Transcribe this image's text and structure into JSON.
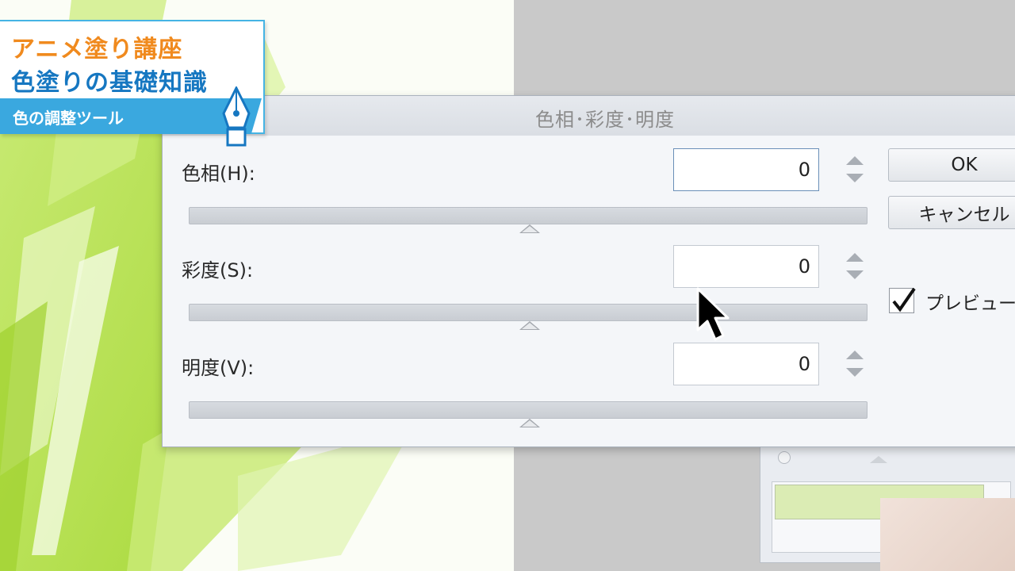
{
  "tutorial": {
    "line1": "アニメ塗り講座",
    "line2": "色塗りの基礎知識",
    "section": "色の調整ツール",
    "accent_orange": "#f08a1e",
    "accent_blue": "#1677c1",
    "ribbon_color": "#3aa8df",
    "icon": "pen-nib-icon"
  },
  "dialog": {
    "title": "色相･彩度･明度",
    "rows": [
      {
        "label": "色相(H):",
        "value": "0"
      },
      {
        "label": "彩度(S):",
        "value": "0"
      },
      {
        "label": "明度(V):",
        "value": "0"
      }
    ],
    "buttons": {
      "ok": "OK",
      "cancel": "キャンセル"
    },
    "preview": {
      "label": "プレビュー(",
      "checked": true
    }
  },
  "cursor": "arrow-cursor-icon",
  "colors": {
    "canvas_green": "#b7e04a",
    "workspace_gray": "#c9c9c9",
    "dialog_bg": "#f4f6f9"
  }
}
